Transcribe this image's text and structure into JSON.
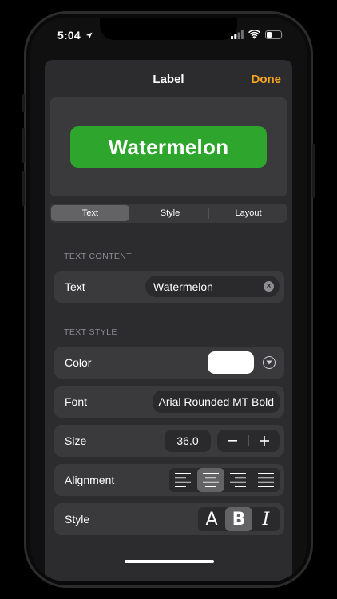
{
  "status": {
    "time": "5:04"
  },
  "nav": {
    "title": "Label",
    "done_label": "Done"
  },
  "preview": {
    "text": "Watermelon",
    "background_color": "#2ea52c"
  },
  "tabs": [
    {
      "label": "Text",
      "selected": true
    },
    {
      "label": "Style",
      "selected": false
    },
    {
      "label": "Layout",
      "selected": false
    }
  ],
  "text_content": {
    "header": "TEXT CONTENT",
    "text_row": {
      "label": "Text",
      "value": "Watermelon"
    }
  },
  "text_style": {
    "header": "TEXT STYLE",
    "color_row": {
      "label": "Color",
      "value_color": "#ffffff"
    },
    "font_row": {
      "label": "Font",
      "value": "Arial Rounded MT Bold"
    },
    "size_row": {
      "label": "Size",
      "value": "36.0",
      "decrement_icon": "minus-icon",
      "increment_icon": "plus-icon"
    },
    "alignment_row": {
      "label": "Alignment",
      "options": [
        "left",
        "center",
        "right",
        "justify"
      ],
      "selected": "center"
    },
    "style_row": {
      "label": "Style",
      "regular": "A",
      "bold": "B",
      "italic": "I",
      "selected": "bold"
    }
  },
  "accent_color": "#f5a623"
}
